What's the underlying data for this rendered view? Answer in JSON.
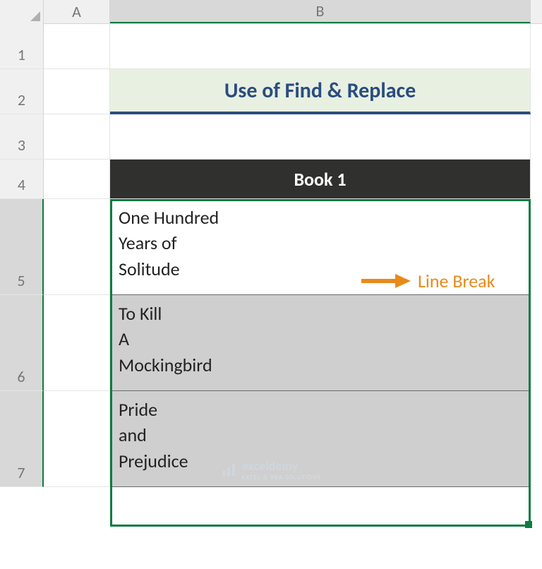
{
  "columns": {
    "A": "A",
    "B": "B"
  },
  "rows": {
    "r1": "1",
    "r2": "2",
    "r3": "3",
    "r4": "4",
    "r5": "5",
    "r6": "6",
    "r7": "7"
  },
  "title": "Use of Find & Replace",
  "tableHeader": "Book 1",
  "books": [
    "One Hundred\nYears of\nSolitude",
    "To Kill\nA\nMockingbird",
    "Pride\nand\nPrejudice"
  ],
  "annotation": "Line Break",
  "watermark": {
    "brand": "exceldemy",
    "tag": "EXCEL & VBA SOLUTIONS"
  },
  "colors": {
    "selection": "#0f7b40",
    "annot": "#e88a1a",
    "titleBg": "#e8f0e2",
    "titleFg": "#2a4d7f"
  }
}
